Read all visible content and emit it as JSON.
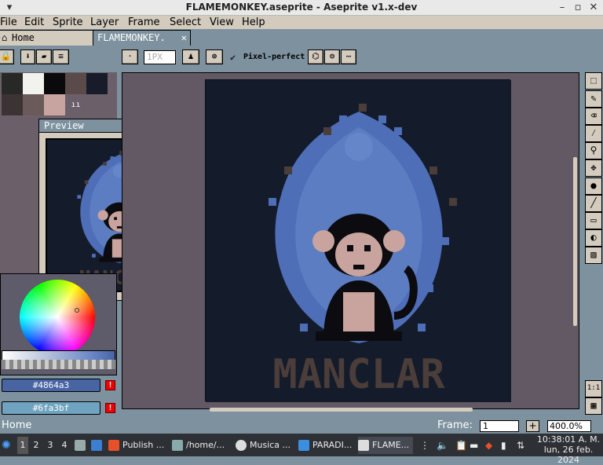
{
  "window": {
    "title": "FLAMEMONKEY.aseprite - Aseprite v1.x-dev"
  },
  "menu": [
    "File",
    "Edit",
    "Sprite",
    "Layer",
    "Frame",
    "Select",
    "View",
    "Help"
  ],
  "tabs": [
    {
      "label": "Home",
      "close": "✕"
    },
    {
      "label": "FLAMEMONKEY.",
      "close": "✕"
    }
  ],
  "toolbar": {
    "brush_size": "1PX",
    "pixel_perfect_label": "Pixel-perfect"
  },
  "palette": {
    "swatches": [
      "#282826",
      "#f2f2ee",
      "#0a0a0c",
      "#5a4a4a",
      "#181c2a",
      "#3c3434",
      "#6a5a5a",
      "#c8a4a0"
    ],
    "index_label": "ıı"
  },
  "colors": {
    "fg_hex": "#4864a3",
    "bg_hex": "#6fa3bf"
  },
  "preview": {
    "title": "Preview"
  },
  "sprite": {
    "text": "MANCLAR",
    "palette": {
      "bg": "#141b2a",
      "flame": "#4f6eb8",
      "flame_light": "#6b8ccc",
      "skin": "#c9a39d",
      "dark": "#0b0b10",
      "brown": "#4a3d3a"
    }
  },
  "status": {
    "left_text": "Home",
    "frame_label": "Frame:",
    "frame_value": "1",
    "add_frame": "+",
    "zoom": "400.0%"
  },
  "right_tools": [
    "marquee-icon",
    "pencil-icon",
    "eraser-icon",
    "eyedropper-icon",
    "zoom-icon",
    "move-icon",
    "bucket-icon",
    "line-icon",
    "rectangle-icon",
    "contour-icon",
    "blur-icon"
  ],
  "taskbar": {
    "workspaces": [
      "1",
      "2",
      "3",
      "4"
    ],
    "tasks": [
      "Publish ...",
      "/home/...",
      "Musica ...",
      "PARADI...",
      "FLAME..."
    ],
    "clock_time": "10:38:01 A. M.",
    "clock_date": "lun, 26 feb. 2024"
  }
}
